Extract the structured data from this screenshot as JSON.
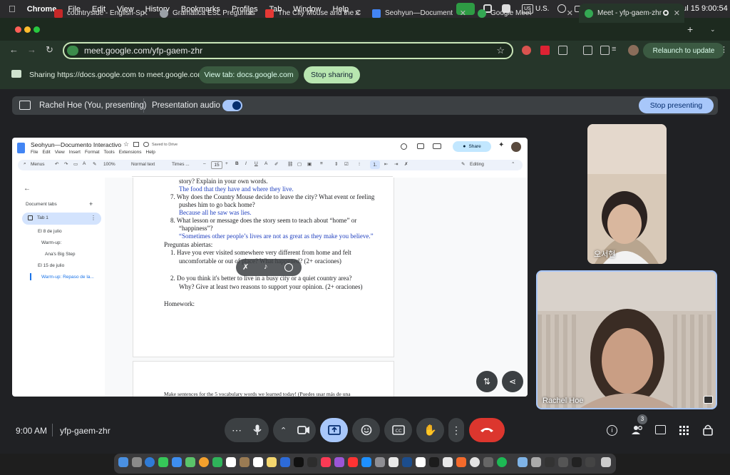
{
  "menubar": {
    "apple": "",
    "items": [
      "Chrome",
      "File",
      "Edit",
      "View",
      "History",
      "Bookmarks",
      "Profiles",
      "Tab",
      "Window",
      "Help"
    ],
    "input_source": "U.S.",
    "clock": "Tue Jul 15  9:00:54"
  },
  "tabs": [
    {
      "title": "countryside - English-Sp",
      "icon_color": "#c62828"
    },
    {
      "title": "Gramática ESL Preguntas",
      "icon_color": "#9aa0a6"
    },
    {
      "title": "The City Mouse and the C",
      "icon_color": "#e53935"
    },
    {
      "title": "Seohyun—Document",
      "icon_color": "#4285f4"
    },
    {
      "title": "Google Meet",
      "icon_color": "#34a853"
    },
    {
      "title": "Meet - yfp-gaem-zhr",
      "icon_color": "#34a853"
    }
  ],
  "omnibox": {
    "url": "meet.google.com/yfp-gaem-zhr"
  },
  "relaunch_label": "Relaunch to update",
  "sharebar": {
    "text": "Sharing https://docs.google.com to meet.google.com",
    "view_tab": "View tab: docs.google.com",
    "stop_sharing": "Stop sharing"
  },
  "presenting": {
    "label": "Rachel Hoe (You, presenting)",
    "audio": "Presentation audio",
    "stop": "Stop presenting"
  },
  "doc": {
    "title": "Seohyun—Documento Interactivo",
    "saved": "Saved to Drive",
    "menus": [
      "File",
      "Edit",
      "View",
      "Insert",
      "Format",
      "Tools",
      "Extensions",
      "Help"
    ],
    "share": "Share",
    "toolbar": {
      "search": "Menus",
      "zoom": "100%",
      "style": "Normal text",
      "font": "Times ...",
      "size": "15",
      "mode": "Editing"
    },
    "sidebar": {
      "heading": "Document tabs",
      "items": [
        "Tab 1",
        "El 8 de julio",
        "Warm-up:",
        "Ana's Big Step",
        "El 15 de julio",
        "Warm-up: Repaso de la..."
      ]
    },
    "lines": [
      "story? Explain in your own words.",
      "The food that they have and where they live.",
      "7.   Why does the Country Mouse decide to leave the city? What event or feeling",
      "pushes him to go back home?",
      "Because all he saw was lies.",
      "8.    What lesson or message does the story seem to teach about “home” or",
      "“happiness”?",
      "“Sometimes other people’s lives are not as great as they make you believe.”",
      "Preguntas abiertas:",
      "1.   Have you ever visited somewhere very different from home and felt",
      "uncomfortable or out of place? What happened? (2+ oraciones)",
      "2.   Do you think it's better to live in a busy city or a quiet country area?",
      "Why? Give at least two reasons to support your opinion. (2+ oraciones)",
      "Homework:",
      "Make sentences for the 5 vocabulary words we learned today! (Puedes usar más de una"
    ]
  },
  "participants": {
    "top": "오서현",
    "self": "Rachel Hoe"
  },
  "bottom": {
    "time": "9:00 AM",
    "meeting_code": "yfp-gaem-zhr",
    "people_count": "3"
  }
}
